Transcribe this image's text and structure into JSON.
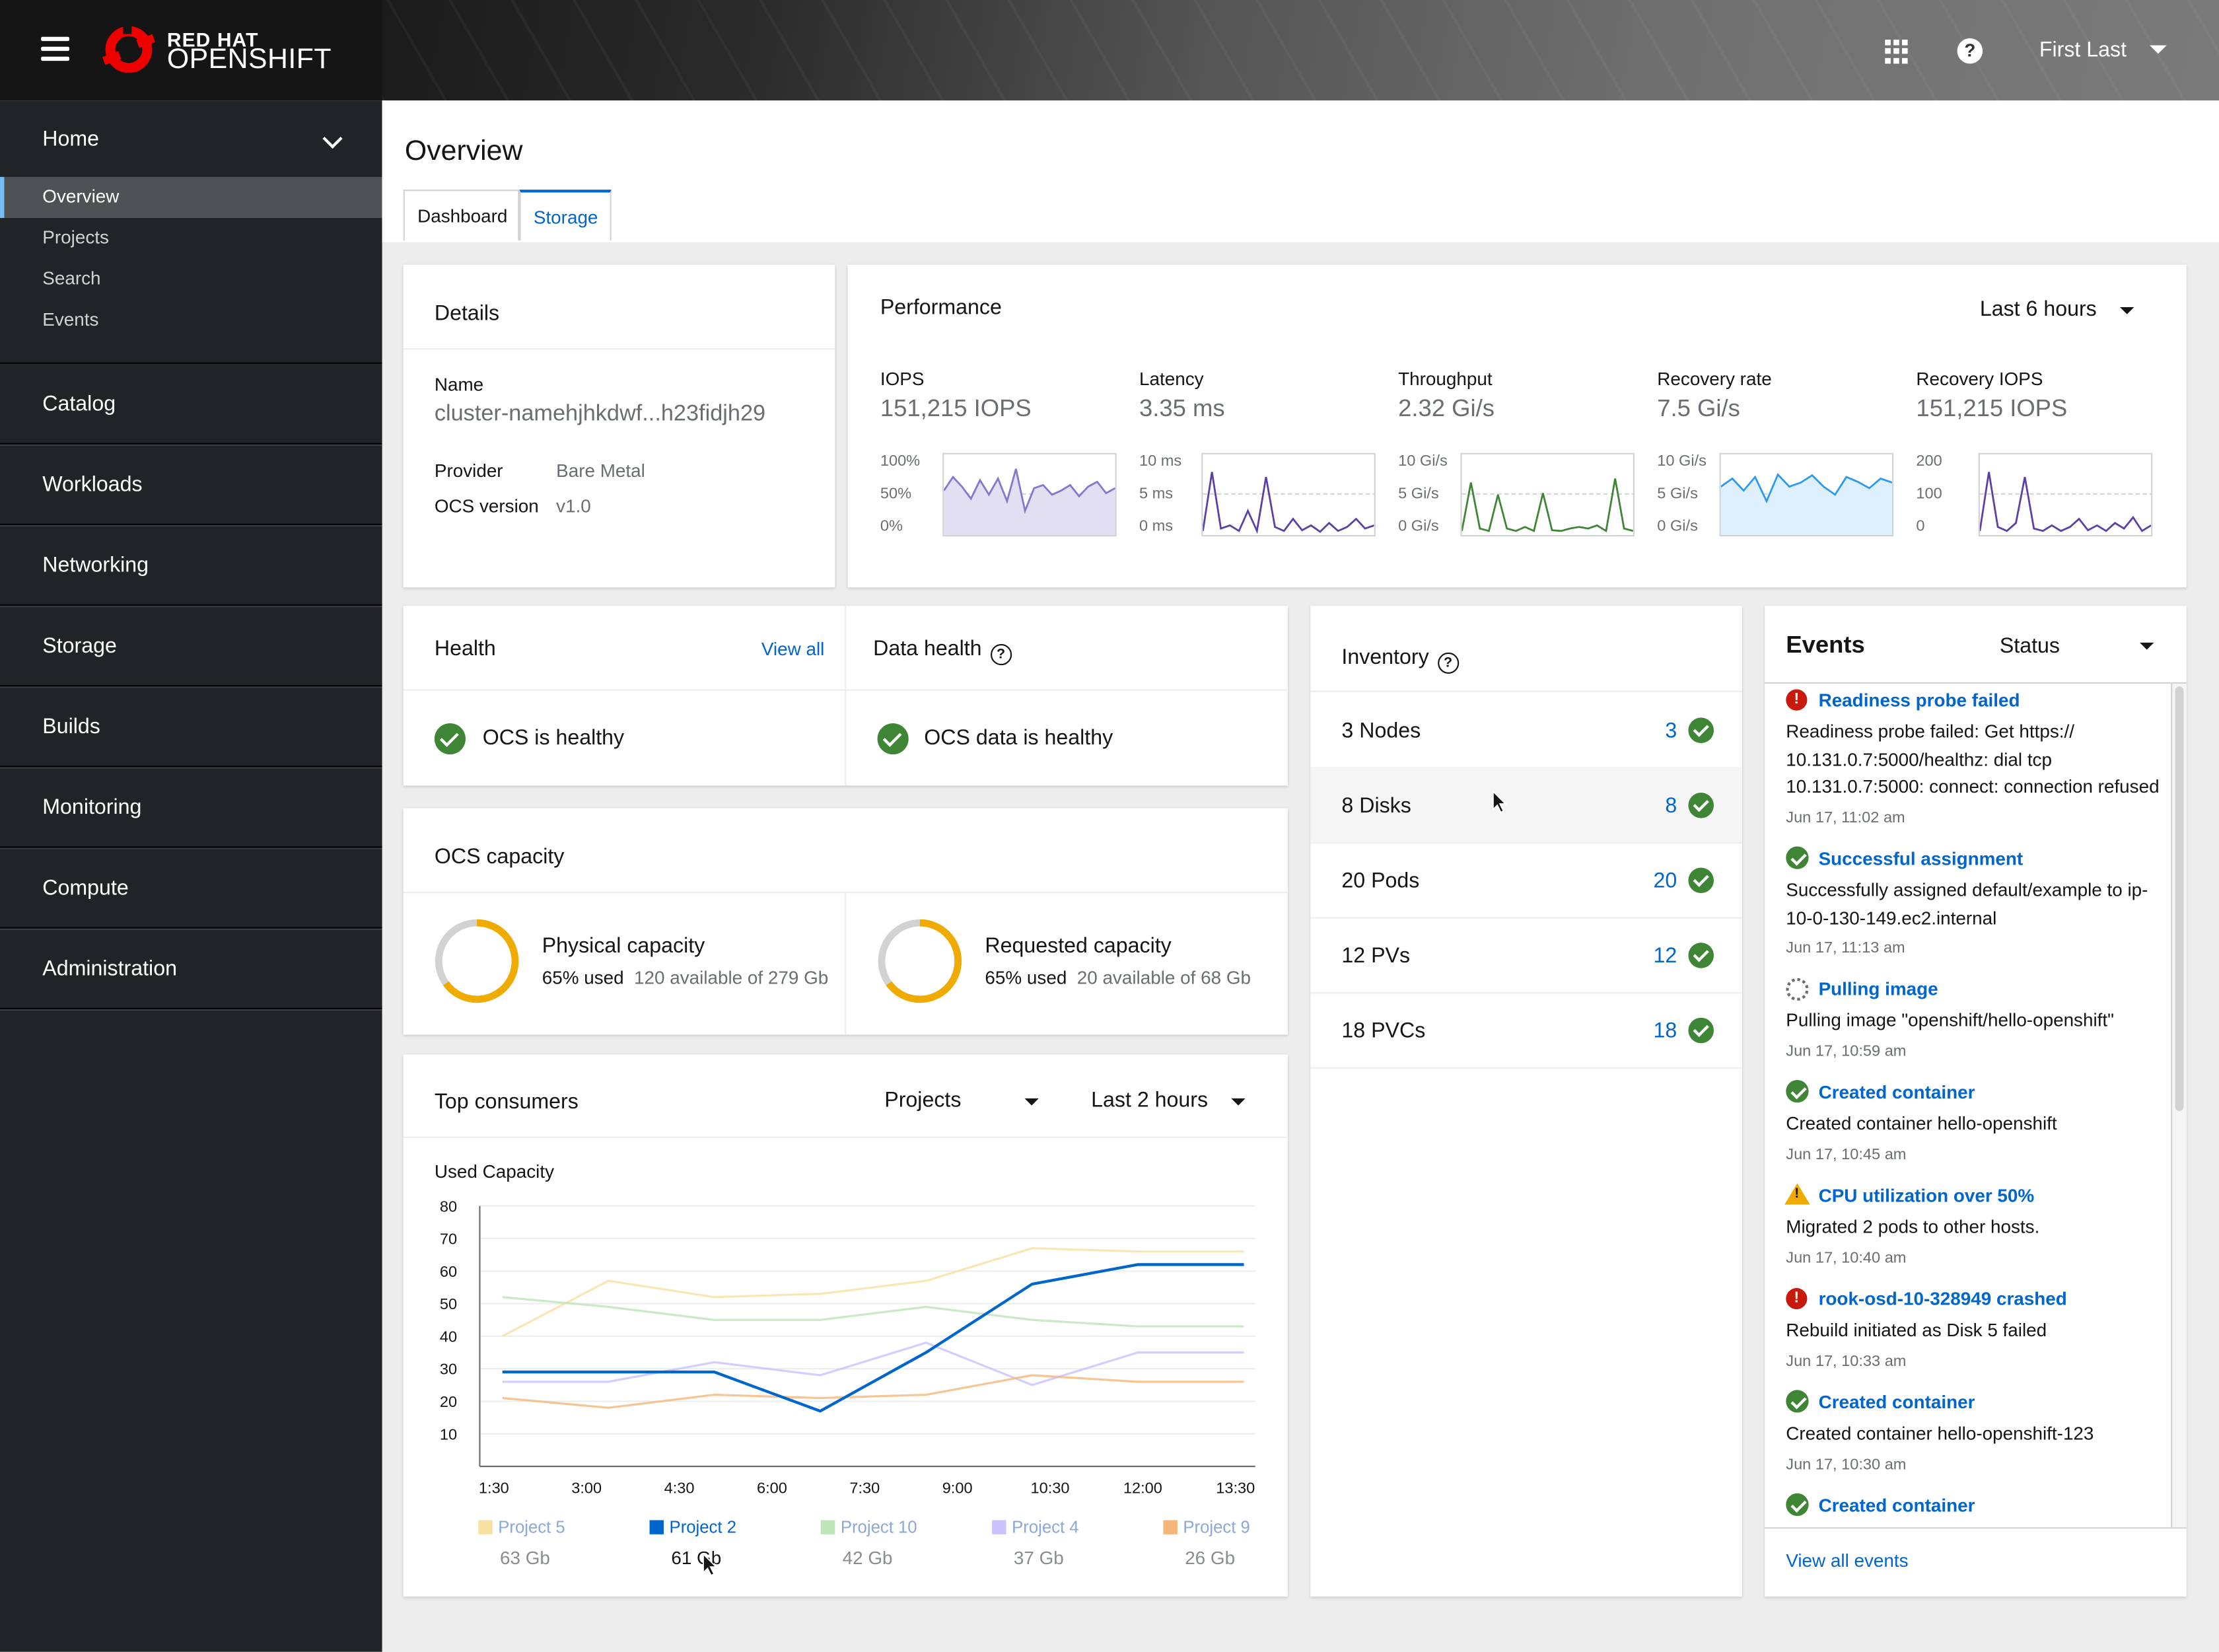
{
  "masthead": {
    "brand_top": "RED HAT",
    "brand_bottom": "OPENSHIFT",
    "user": "First Last"
  },
  "sidebar": {
    "home": "Home",
    "sub_items": [
      "Overview",
      "Projects",
      "Search",
      "Events"
    ],
    "sections": [
      "Catalog",
      "Workloads",
      "Networking",
      "Storage",
      "Builds",
      "Monitoring",
      "Compute",
      "Administration"
    ]
  },
  "page": {
    "title": "Overview",
    "tabs": [
      "Dashboard",
      "Storage"
    ]
  },
  "details": {
    "title": "Details",
    "name_label": "Name",
    "name_value": "cluster-namehjhkdwf...h23fidjh29",
    "provider_label": "Provider",
    "provider_value": "Bare Metal",
    "version_label": "OCS version",
    "version_value": "v1.0"
  },
  "performance": {
    "title": "Performance",
    "range": "Last 6 hours",
    "metrics": [
      {
        "label": "IOPS",
        "value": "151,215 IOPS",
        "ticks": [
          "100%",
          "50%",
          "0%"
        ],
        "color": "#8476d1",
        "fill": "#e2dff3"
      },
      {
        "label": "Latency",
        "value": "3.35 ms",
        "ticks": [
          "10 ms",
          "5 ms",
          "0 ms"
        ],
        "color": "#5c40a8",
        "fill": "none"
      },
      {
        "label": "Throughput",
        "value": "2.32 Gi/s",
        "ticks": [
          "10 Gi/s",
          "5 Gi/s",
          "0 Gi/s"
        ],
        "color": "#3e8635",
        "fill": "none"
      },
      {
        "label": "Recovery rate",
        "value": "7.5 Gi/s",
        "ticks": [
          "10 Gi/s",
          "5 Gi/s",
          "0 Gi/s"
        ],
        "color": "#2b9af3",
        "fill": "#def0fd"
      },
      {
        "label": "Recovery IOPS",
        "value": "151,215 IOPS",
        "ticks": [
          "200",
          "100",
          "0"
        ],
        "color": "#5c40a8",
        "fill": "none"
      }
    ]
  },
  "health": {
    "title": "Health",
    "view_all": "View all",
    "status": "OCS is healthy",
    "data_title": "Data health",
    "data_status": "OCS data is healthy"
  },
  "capacity": {
    "title": "OCS capacity",
    "physical": {
      "label": "Physical capacity",
      "used": "65% used",
      "available": "120 available of 279 Gb",
      "percent": 65
    },
    "requested": {
      "label": "Requested capacity",
      "used": "65% used",
      "available": "20 available of 68 Gb",
      "percent": 65
    }
  },
  "consumers": {
    "title": "Top consumers",
    "filter": "Projects",
    "range": "Last 2 hours",
    "ylabel": "Used Capacity"
  },
  "chart_data": {
    "type": "line",
    "title": "",
    "ylabel": "Used Capacity",
    "ylim": [
      0,
      80
    ],
    "yticks": [
      80,
      70,
      60,
      50,
      40,
      30,
      20,
      10
    ],
    "categories": [
      "1:30",
      "3:00",
      "4:30",
      "6:00",
      "7:30",
      "9:00",
      "10:30",
      "12:00",
      "13:30"
    ],
    "x": [
      "1:30",
      "3:00",
      "4:30",
      "6:00",
      "7:30",
      "9:00",
      "10:30",
      "12:00",
      "13:30"
    ],
    "series": [
      {
        "name": "Project 5",
        "total": "63 Gb",
        "color": "#f9e0a2",
        "highlight": false,
        "values": [
          40,
          57,
          52,
          53,
          57,
          67,
          66,
          66
        ]
      },
      {
        "name": "Project 2",
        "total": "61 Gb",
        "color": "#0066cc",
        "highlight": true,
        "values": [
          29,
          29,
          29,
          17,
          35,
          56,
          62,
          62
        ]
      },
      {
        "name": "Project 10",
        "total": "42 Gb",
        "color": "#bde5b8",
        "highlight": false,
        "values": [
          52,
          49,
          45,
          45,
          49,
          45,
          43,
          43
        ]
      },
      {
        "name": "Project 4",
        "total": "37 Gb",
        "color": "#cbc1ff",
        "highlight": false,
        "values": [
          26,
          26,
          32,
          28,
          38,
          25,
          35,
          35
        ]
      },
      {
        "name": "Project 9",
        "total": "26 Gb",
        "color": "#f4b678",
        "highlight": false,
        "values": [
          21,
          18,
          22,
          21,
          22,
          28,
          26,
          26
        ]
      }
    ]
  },
  "inventory": {
    "title": "Inventory",
    "rows": [
      {
        "label": "3 Nodes",
        "count": "3"
      },
      {
        "label": "8 Disks",
        "count": "8"
      },
      {
        "label": "20 Pods",
        "count": "20"
      },
      {
        "label": "12 PVs",
        "count": "12"
      },
      {
        "label": "18 PVCs",
        "count": "18"
      }
    ]
  },
  "events": {
    "title": "Events",
    "filter": "Status",
    "view_all": "View all events",
    "items": [
      {
        "icon": "error",
        "title": "Readiness probe failed",
        "message": "Readiness probe failed: Get https:// 10.131.0.7:5000/healthz: dial tcp 10.131.0.7:5000: connect: connection refused",
        "time": "Jun 17, 11:02 am"
      },
      {
        "icon": "success",
        "title": "Successful assignment",
        "message": "Successfully assigned default/example to ip-10-0-130-149.ec2.internal",
        "time": "Jun 17, 11:13 am"
      },
      {
        "icon": "progress",
        "title": "Pulling image",
        "message": "Pulling image \"openshift/hello-openshift\"",
        "time": "Jun 17, 10:59 am"
      },
      {
        "icon": "success",
        "title": "Created container",
        "message": "Created container hello-openshift",
        "time": "Jun 17, 10:45 am"
      },
      {
        "icon": "warning",
        "title": "CPU utilization over 50%",
        "message": "Migrated 2 pods to other hosts.",
        "time": "Jun 17, 10:40 am"
      },
      {
        "icon": "error",
        "title": "rook-osd-10-328949 crashed",
        "message": "Rebuild initiated as Disk 5 failed",
        "time": "Jun 17, 10:33 am"
      },
      {
        "icon": "success",
        "title": "Created container",
        "message": "Created container hello-openshift-123",
        "time": "Jun 17, 10:30 am"
      },
      {
        "icon": "success",
        "title": "Created container",
        "message": "",
        "time": ""
      }
    ]
  }
}
